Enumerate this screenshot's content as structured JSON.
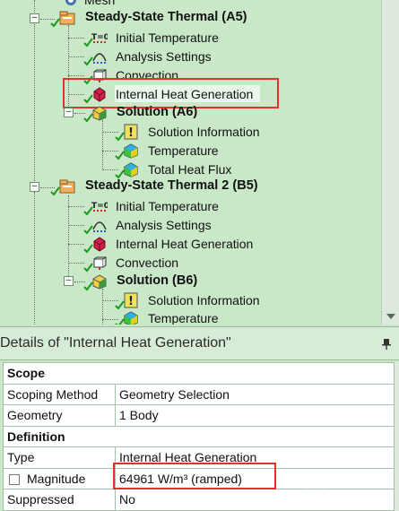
{
  "tree": {
    "top_label": "Mesh",
    "a5": {
      "label": "Steady-State Thermal (A5)",
      "children": [
        "Initial Temperature",
        "Analysis Settings",
        "Convection",
        "Internal Heat Generation"
      ],
      "solution_label": "Solution (A6)",
      "solution_children": [
        "Solution Information",
        "Temperature",
        "Total Heat Flux"
      ]
    },
    "b5": {
      "label": "Steady-State Thermal 2 (B5)",
      "children": [
        "Initial Temperature",
        "Analysis Settings",
        "Internal Heat Generation",
        "Convection"
      ],
      "solution_label": "Solution (B6)",
      "solution_children": [
        "Solution Information",
        "Temperature"
      ]
    }
  },
  "details": {
    "title": "Details of \"Internal Heat Generation\"",
    "scope": {
      "header": "Scope",
      "rows": [
        {
          "name": "Scoping Method",
          "value": "Geometry Selection"
        },
        {
          "name": "Geometry",
          "value": "1 Body"
        }
      ]
    },
    "definition": {
      "header": "Definition",
      "rows": [
        {
          "name": "Type",
          "value": "Internal Heat Generation"
        },
        {
          "name": "Magnitude",
          "value": "64961 W/m³  (ramped)"
        },
        {
          "name": "Suppressed",
          "value": "No"
        }
      ]
    }
  },
  "colors": {
    "tree_bg": "#c8e8c8",
    "highlight": "#e0312b",
    "check": "#1a9a1a"
  }
}
